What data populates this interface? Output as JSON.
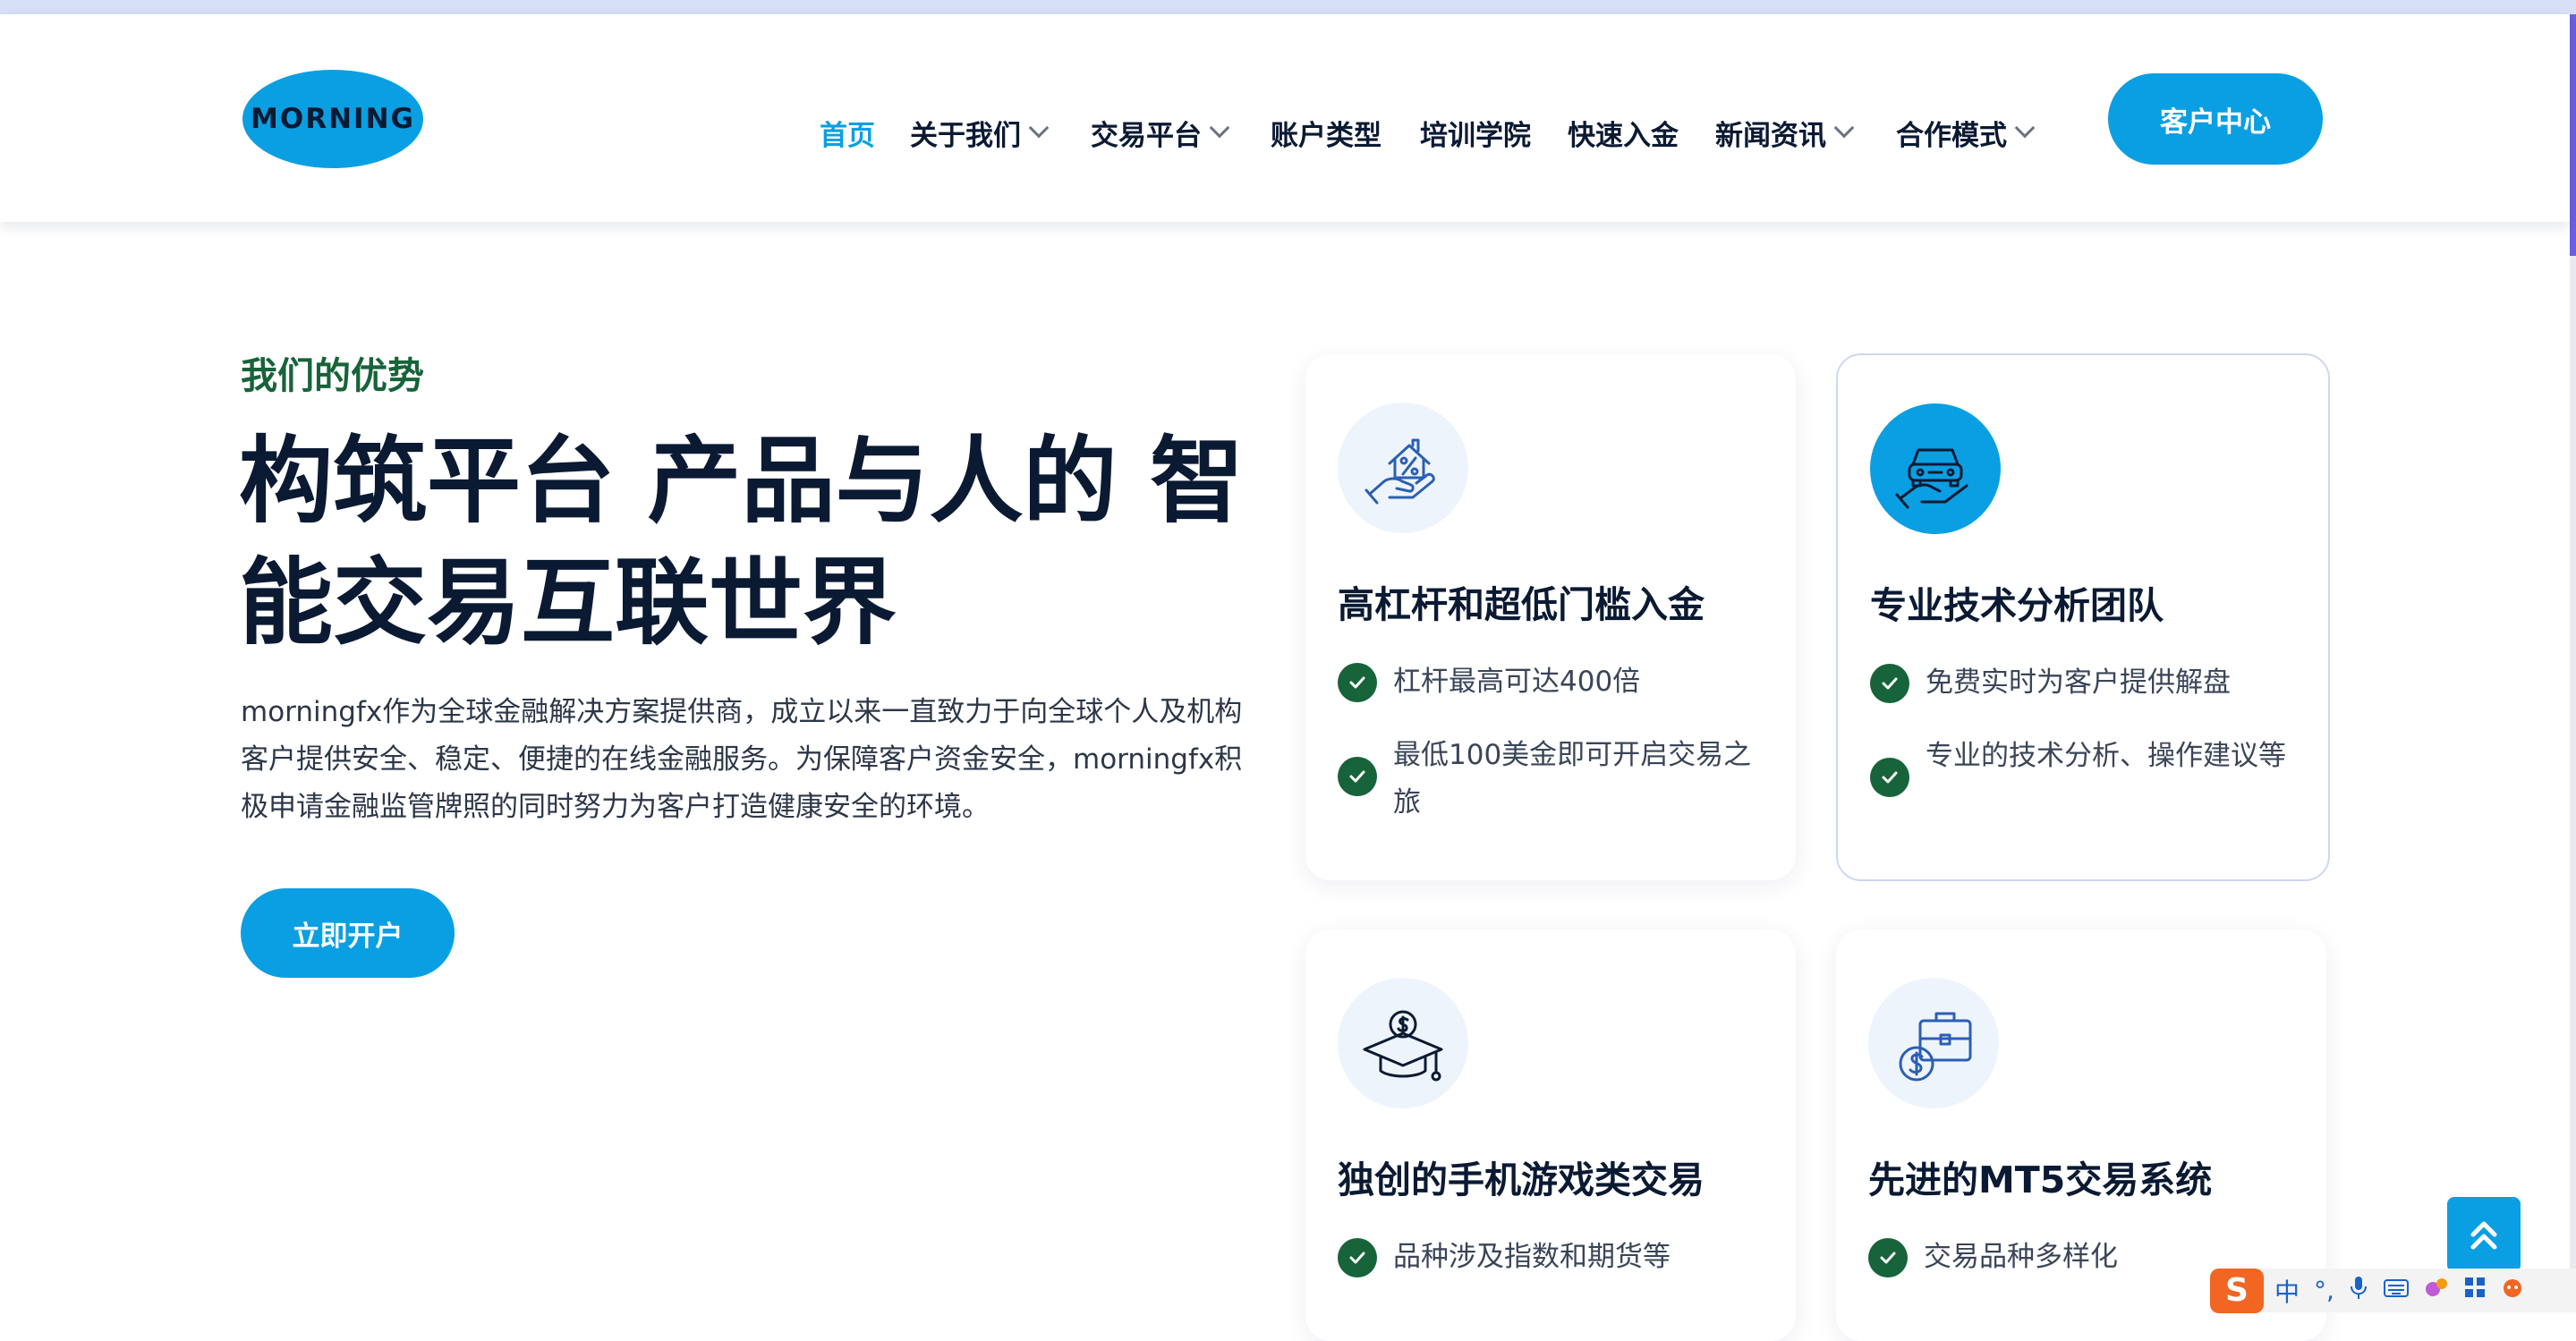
{
  "header": {
    "logo_text": "MORNING",
    "nav": [
      {
        "label": "首页",
        "active": true,
        "has_dropdown": false
      },
      {
        "label": "关于我们",
        "active": false,
        "has_dropdown": true
      },
      {
        "label": "交易平台",
        "active": false,
        "has_dropdown": true
      },
      {
        "label": "账户类型",
        "active": false,
        "has_dropdown": false
      },
      {
        "label": "培训学院",
        "active": false,
        "has_dropdown": false
      },
      {
        "label": "快速入金",
        "active": false,
        "has_dropdown": false
      },
      {
        "label": "新闻资讯",
        "active": false,
        "has_dropdown": true
      },
      {
        "label": "合作模式",
        "active": false,
        "has_dropdown": true
      }
    ],
    "cta_label": "客户中心"
  },
  "hero": {
    "subtitle": "我们的优势",
    "headline_line1": "构筑平台 产品与人的 智",
    "headline_line2": "能交易互联世界",
    "description": "morningfx作为全球金融解决方案提供商，成立以来一直致力于向全球个人及机构客户提供安全、稳定、便捷的在线金融服务。为保障客户资金安全，morningfx积极申请金融监管牌照的同时努力为客户打造健康安全的环境。",
    "cta_label": "立即开户"
  },
  "cards": [
    {
      "icon": "house-in-hand-icon",
      "title": "高杠杆和超低门槛入金",
      "features": [
        "杠杆最高可达400倍",
        "最低100美金即可开启交易之旅"
      ]
    },
    {
      "icon": "car-in-hand-icon",
      "title": "专业技术分析团队",
      "features": [
        "免费实时为客户提供解盘",
        "专业的技术分析、操作建议等"
      ]
    },
    {
      "icon": "graduation-cap-dollar-icon",
      "title": "独创的手机游戏类交易",
      "features": [
        "品种涉及指数和期货等"
      ]
    },
    {
      "icon": "briefcase-dollar-icon",
      "title": "先进的MT5交易系统",
      "features": [
        "交易品种多样化"
      ]
    }
  ],
  "ime_toolbar": {
    "logo": "S",
    "mode": "中",
    "punct": "°,"
  },
  "colors": {
    "primary": "#0a9fe2",
    "accent_green": "#17633a",
    "heading": "#0b1a33"
  }
}
